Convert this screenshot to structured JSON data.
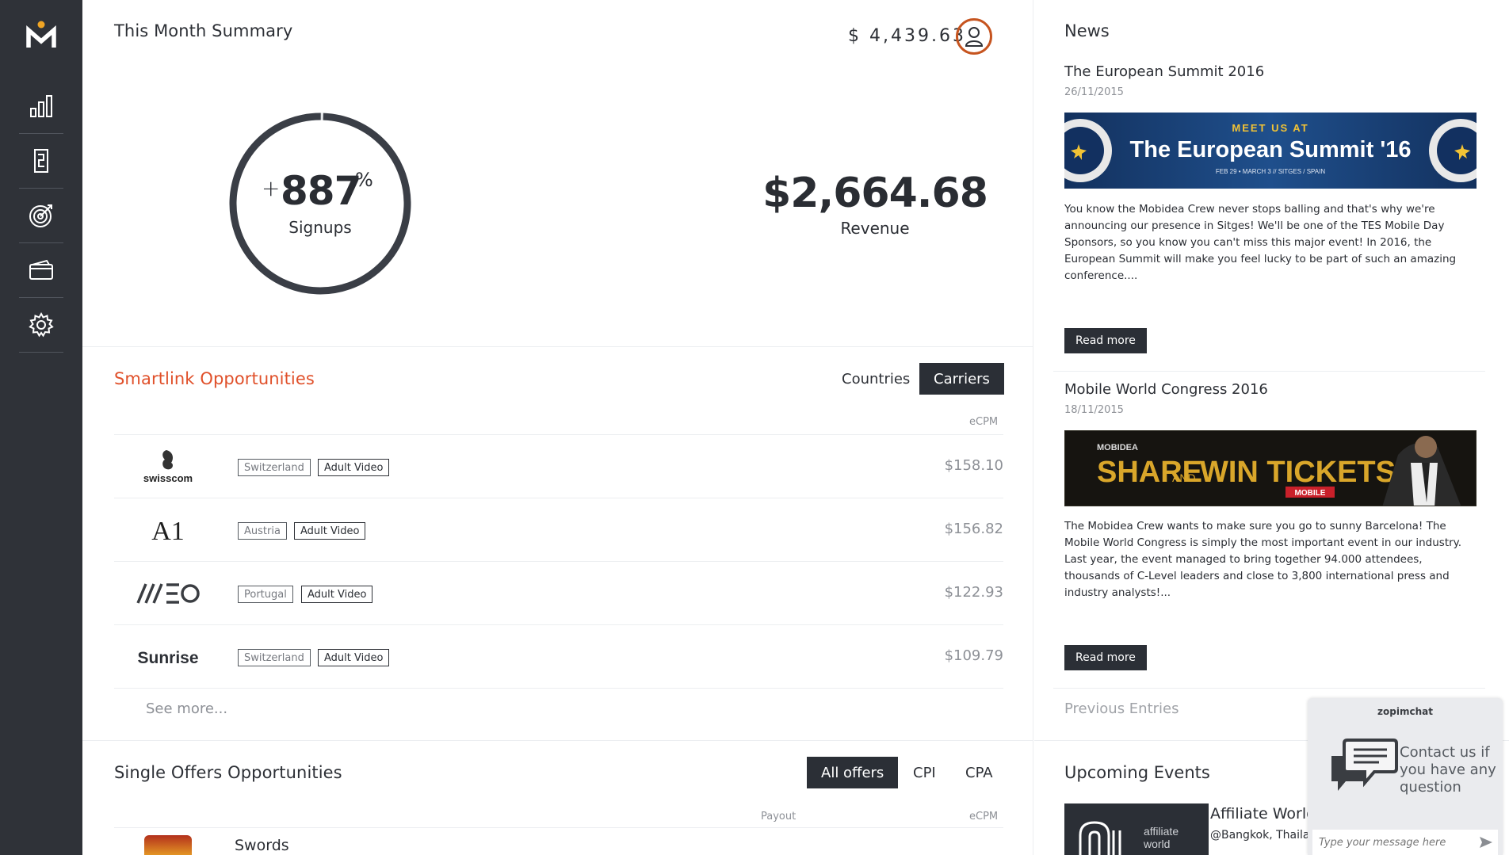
{
  "sidebar": {
    "logo": "M",
    "items": [
      {
        "icon": "bar-chart-icon"
      },
      {
        "icon": "document-icon"
      },
      {
        "icon": "target-icon"
      },
      {
        "icon": "wallet-icon"
      },
      {
        "icon": "gear-icon"
      }
    ]
  },
  "summary": {
    "title": "This Month Summary",
    "balance": "$ 4,439.63",
    "signups_prefix": "+",
    "signups_value": "887",
    "signups_unit": "%",
    "signups_label": "Signups",
    "signups_ring_fill": 0.995,
    "revenue_value": "$2,664.68",
    "revenue_label": "Revenue"
  },
  "smartlink": {
    "title": "Smartlink Opportunities",
    "tabs": [
      "Countries",
      "Carriers"
    ],
    "active_tab": "Carriers",
    "column_ecpm": "eCPM",
    "rows": [
      {
        "carrier": "swisscom",
        "country": "Switzerland",
        "category": "Adult Video",
        "ecpm": "$158.10"
      },
      {
        "carrier": "A1",
        "country": "Austria",
        "category": "Adult Video",
        "ecpm": "$156.82"
      },
      {
        "carrier": "MEO",
        "country": "Portugal",
        "category": "Adult Video",
        "ecpm": "$122.93"
      },
      {
        "carrier": "Sunrise",
        "country": "Switzerland",
        "category": "Adult Video",
        "ecpm": "$109.79"
      }
    ],
    "see_more": "See more..."
  },
  "single_offers": {
    "title": "Single Offers Opportunities",
    "tabs": [
      "All offers",
      "CPI",
      "CPA"
    ],
    "active_tab": "All offers",
    "column_payout": "Payout",
    "column_ecpm": "eCPM",
    "first_row_name": "Swords"
  },
  "news": {
    "title": "News",
    "articles": [
      {
        "title": "The European Summit 2016",
        "date": "26/11/2015",
        "banner_top": "MEET US AT",
        "banner_main": "The European Summit '16",
        "banner_sub": "FEB 29 • MARCH 3 // SITGES / SPAIN",
        "body": "You know the Mobidea Crew never stops balling and that's why we're announcing our presence in Sitges! We'll be one of the TES Mobile Day Sponsors, so you know you can't miss this major event! In 2016, the European Summit will make you feel lucky to be part of such an amazing conference....",
        "read_more": "Read more"
      },
      {
        "title": "Mobile World Congress 2016",
        "date": "18/11/2015",
        "banner_top": "MOBIDEA",
        "banner_main_1": "SHARE",
        "banner_main_and": "AND",
        "banner_main_2": "WIN TICKETS",
        "banner_sub": "MOBILE",
        "body": "The Mobidea Crew wants to make sure you go to sunny Barcelona! The Mobile World Congress is simply the most important event in our industry. Last year, the event managed to bring together 94.000 attendees, thousands of C-Level leaders and close to 3,800 international press and industry analysts!...",
        "read_more": "Read more"
      }
    ],
    "previous_entries": "Previous Entries"
  },
  "upcoming": {
    "title": "Upcoming Events",
    "event_title": "Affiliate World A",
    "event_location": "@Bangkok, Thailand,",
    "event_logo_text_1": "affiliate",
    "event_logo_text_2": "world"
  },
  "chat": {
    "brand": "zopimchat",
    "message": "Contact us if you have any question",
    "placeholder": "Type your message here"
  },
  "colors": {
    "sidebar": "#2f3238",
    "accent": "#e0502a",
    "dark_button": "#2b2f36",
    "muted_text": "#8d9096"
  }
}
